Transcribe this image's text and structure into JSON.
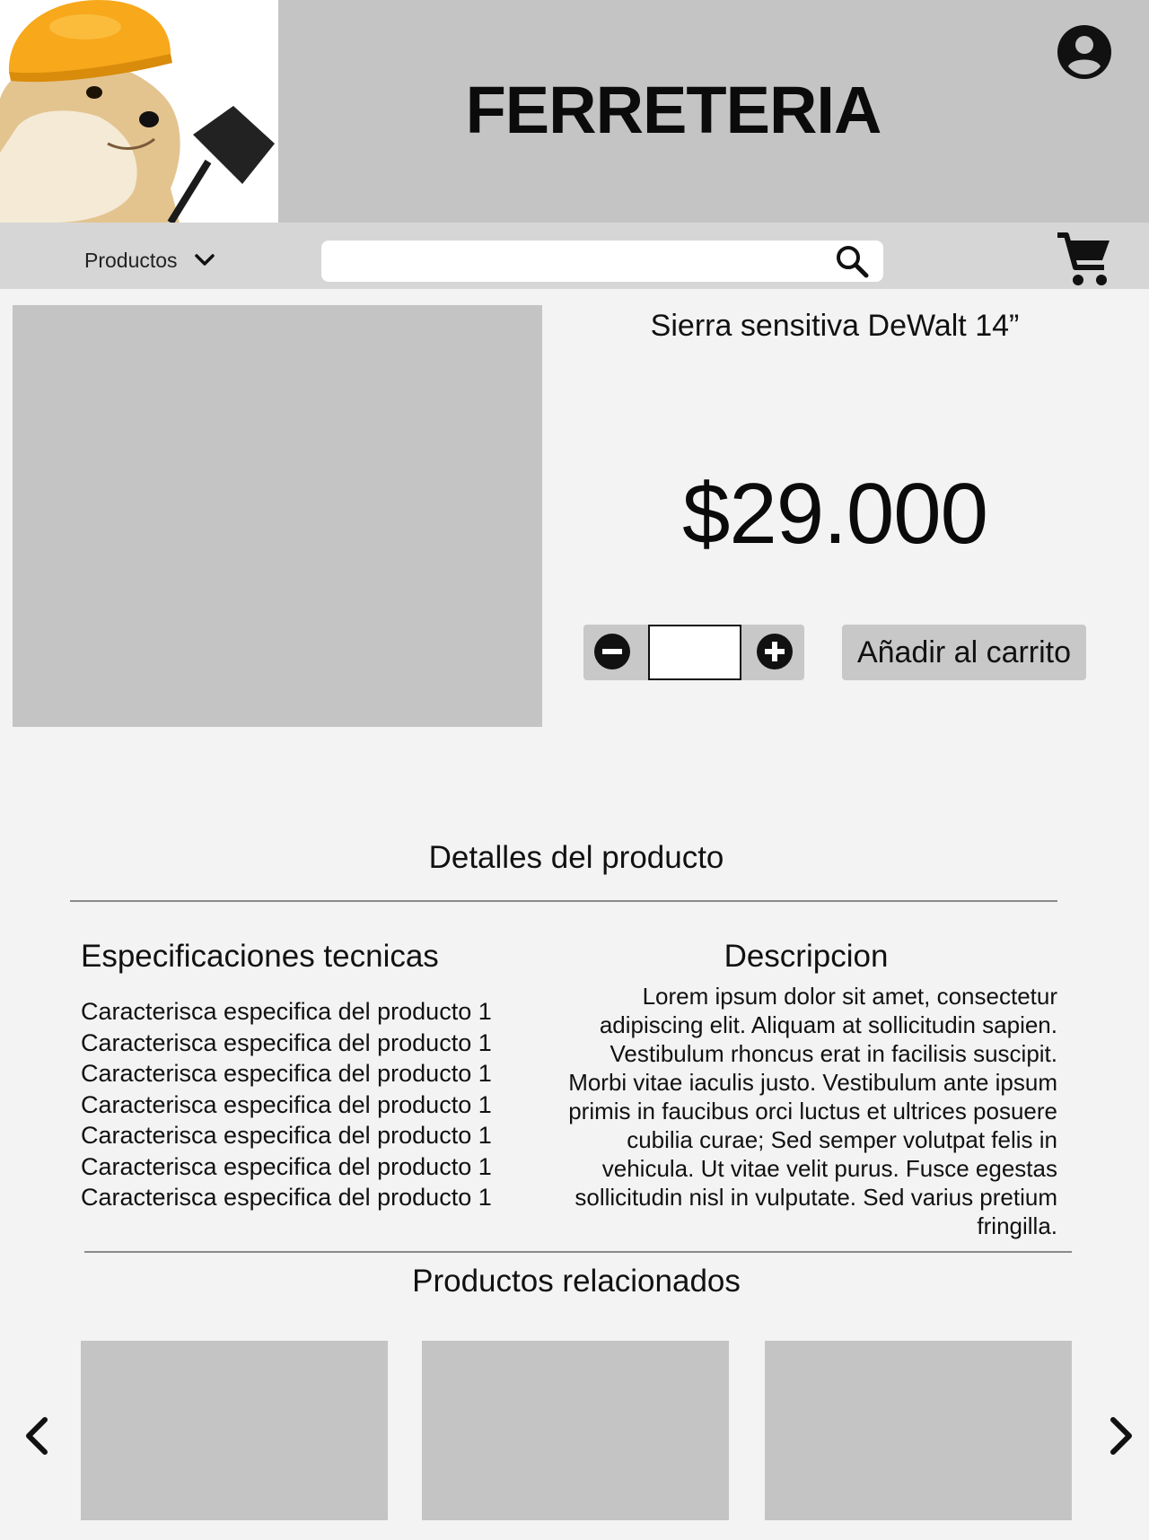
{
  "header": {
    "brand": "FERRETERIA",
    "logo_icon": "doge-construction-logo",
    "account_icon": "account-circle-icon",
    "background_color": "#c4c4c4"
  },
  "navbar": {
    "products_menu_label": "Productos",
    "products_menu_icon": "chevron-down-icon",
    "search": {
      "value": "",
      "placeholder": "",
      "icon": "search-icon"
    },
    "cart_icon": "cart-icon",
    "background_color": "#d6d6d6"
  },
  "product": {
    "name": "Sierra sensitiva DeWalt 14”",
    "price": "$29.000",
    "quantity": {
      "value": "",
      "minus_icon": "minus-circle-icon",
      "plus_icon": "plus-circle-icon"
    },
    "add_to_cart_label": "Añadir al carrito"
  },
  "details": {
    "title": "Detalles del producto",
    "specs_title": "Especificaciones tecnicas",
    "specs": [
      "Caracterisca especifica del producto 1",
      "Caracterisca especifica del producto 1",
      "Caracterisca especifica del producto 1",
      "Caracterisca especifica del producto 1",
      "Caracterisca especifica del producto 1",
      "Caracterisca especifica del producto 1",
      "Caracterisca especifica del producto 1"
    ],
    "description_title": "Descripcion",
    "description": "Lorem ipsum dolor sit amet, consectetur adipiscing elit. Aliquam at sollicitudin sapien. Vestibulum rhoncus erat in facilisis suscipit. Morbi vitae iaculis justo. Vestibulum ante ipsum primis in faucibus orci luctus et ultrices posuere cubilia curae; Sed semper volutpat felis in vehicula. Ut vitae velit purus. Fusce egestas sollicitudin nisl in vulputate. Sed varius pretium fringilla."
  },
  "related": {
    "title": "Productos relacionados",
    "prev_icon": "chevron-left-icon",
    "next_icon": "chevron-right-icon",
    "card_count": 3
  }
}
